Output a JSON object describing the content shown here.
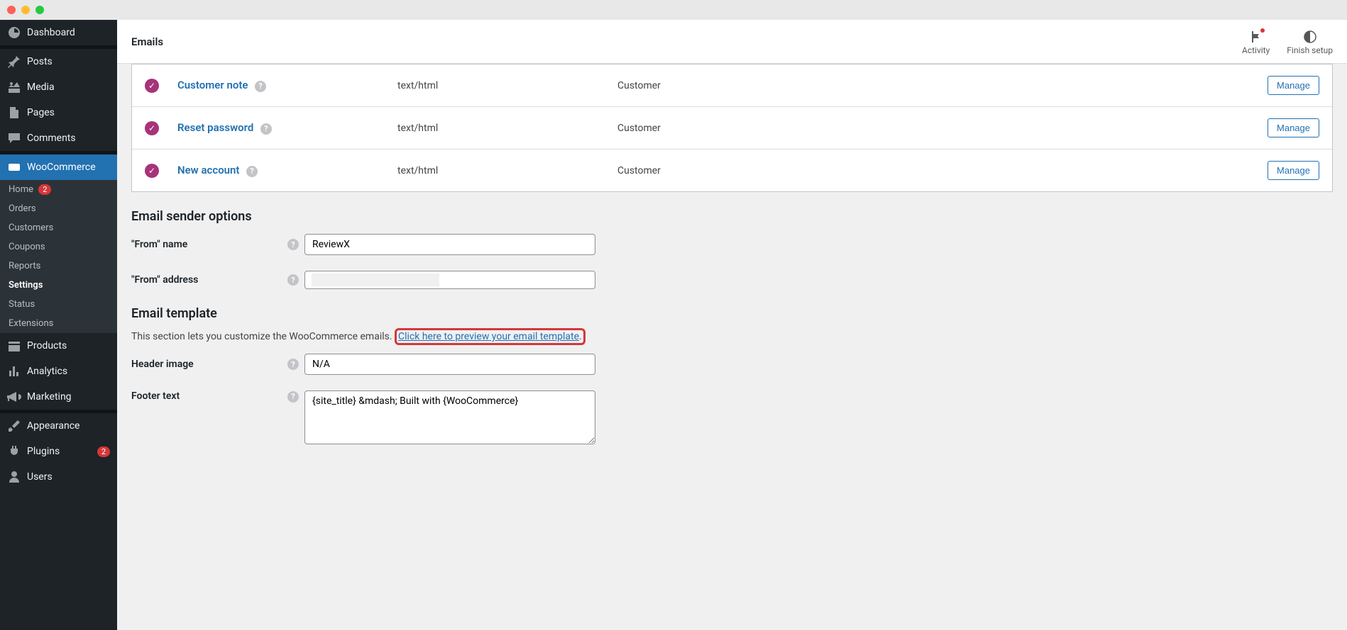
{
  "topbar": {
    "title": "Emails",
    "activity_label": "Activity",
    "finish_label": "Finish setup"
  },
  "sidebar": {
    "dashboard": "Dashboard",
    "posts": "Posts",
    "media": "Media",
    "pages": "Pages",
    "comments": "Comments",
    "woocommerce": "WooCommerce",
    "submenu": {
      "home": "Home",
      "home_badge": "2",
      "orders": "Orders",
      "customers": "Customers",
      "coupons": "Coupons",
      "reports": "Reports",
      "settings": "Settings",
      "status": "Status",
      "extensions": "Extensions"
    },
    "products": "Products",
    "analytics": "Analytics",
    "marketing": "Marketing",
    "appearance": "Appearance",
    "plugins": "Plugins",
    "plugins_badge": "2",
    "users": "Users"
  },
  "email_rows": {
    "row1": {
      "name": "Customer note",
      "type": "text/html",
      "recipient": "Customer",
      "manage": "Manage"
    },
    "row2": {
      "name": "Reset password",
      "type": "text/html",
      "recipient": "Customer",
      "manage": "Manage"
    },
    "row3": {
      "name": "New account",
      "type": "text/html",
      "recipient": "Customer",
      "manage": "Manage"
    }
  },
  "sections": {
    "sender_heading": "Email sender options",
    "template_heading": "Email template",
    "template_desc_pre": "This section lets you customize the WooCommerce emails. ",
    "template_desc_link": "Click here to preview your email template",
    "template_desc_post": "."
  },
  "form": {
    "from_name_label": "\"From\" name",
    "from_name_value": "ReviewX",
    "from_address_label": "\"From\" address",
    "header_image_label": "Header image",
    "header_image_value": "N/A",
    "footer_text_label": "Footer text",
    "footer_text_value": "{site_title} &mdash; Built with {WooCommerce}"
  }
}
